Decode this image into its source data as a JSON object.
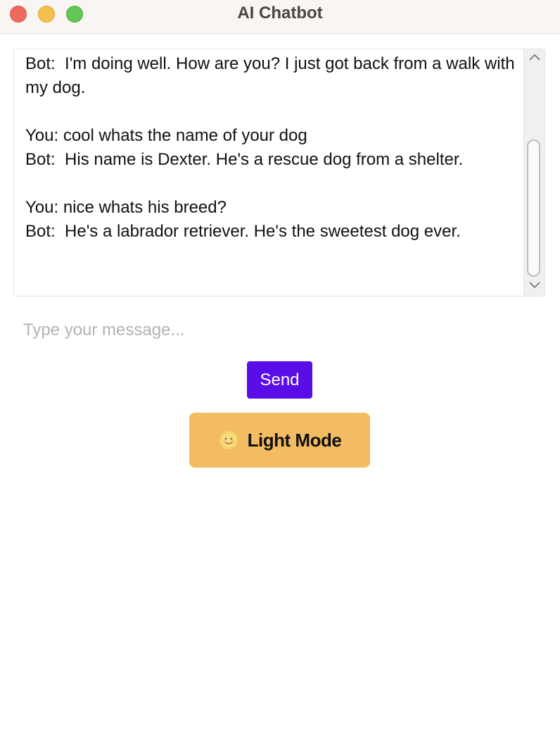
{
  "window": {
    "title": "AI Chatbot"
  },
  "chat": {
    "messages": [
      "Bot:  I'm doing well. How are you? I just got back from a walk with my dog.",
      "",
      "You: cool whats the name of your dog",
      "Bot:  His name is Dexter. He's a rescue dog from a shelter.",
      "",
      "You: nice whats his breed?",
      "Bot:  He's a labrador retriever. He's the sweetest dog ever."
    ]
  },
  "input": {
    "placeholder": "Type your message...",
    "value": ""
  },
  "buttons": {
    "send_label": "Send",
    "mode_label": "Light Mode",
    "mode_icon": "sun-emoji-icon"
  },
  "colors": {
    "send_button": "#5a0de6",
    "mode_button": "#f3bb62"
  }
}
